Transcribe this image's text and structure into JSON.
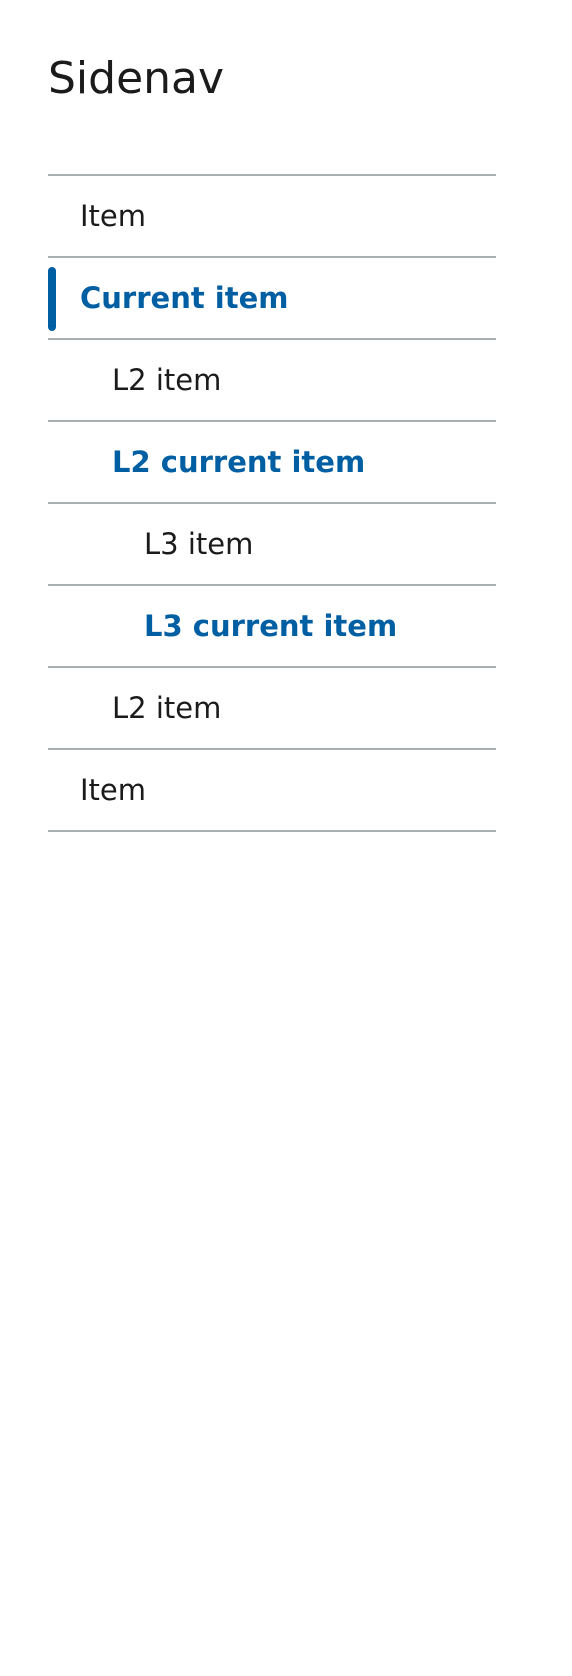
{
  "page": {
    "title": "Sidenav"
  },
  "sidenav": {
    "items": [
      {
        "label": "Item",
        "level": 1,
        "current": false
      },
      {
        "label": "Current item",
        "level": 1,
        "current": true
      },
      {
        "label": "L2 item",
        "level": 2,
        "current": false
      },
      {
        "label": "L2 current item",
        "level": 2,
        "current": true
      },
      {
        "label": "L3 item",
        "level": 3,
        "current": false
      },
      {
        "label": "L3 current item",
        "level": 3,
        "current": true
      },
      {
        "label": "L2 item",
        "level": 2,
        "current": false
      },
      {
        "label": "Item",
        "level": 1,
        "current": false
      }
    ]
  },
  "colors": {
    "accent": "#005ea2",
    "text": "#1b1b1b",
    "divider": "#a9aeb1",
    "background": "#ffffff"
  }
}
